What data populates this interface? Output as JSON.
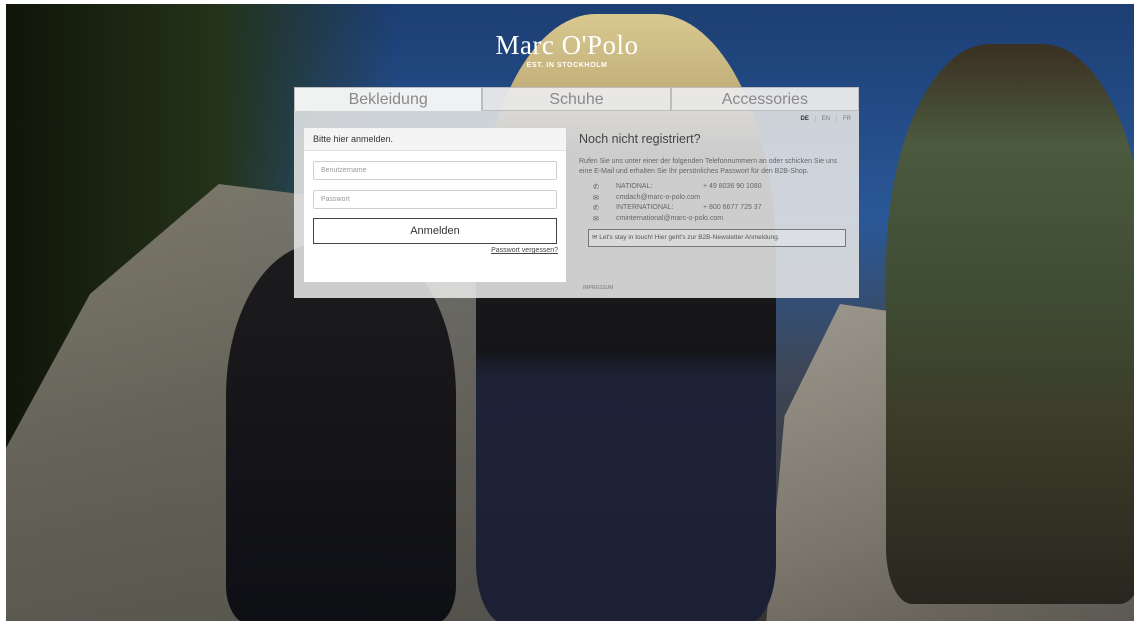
{
  "brand": {
    "name": "Marc O'Polo",
    "tagline": "EST. IN STOCKHOLM"
  },
  "tabs": [
    {
      "label": "Bekleidung",
      "active": true
    },
    {
      "label": "Schuhe",
      "active": false
    },
    {
      "label": "Accessories",
      "active": false
    }
  ],
  "languages": [
    "DE",
    "EN",
    "FR"
  ],
  "login": {
    "title": "Bitte hier anmelden.",
    "username_placeholder": "Benutzername",
    "password_placeholder": "Passwort",
    "submit_label": "Anmelden",
    "forgot_label": "Passwort vergessen?"
  },
  "register": {
    "title": "Noch nicht registriert?",
    "text": "Rufen Sie uns unter einer der folgenden Telefonnummern an oder schicken Sie uns eine E-Mail und erhalten Sie Ihr persönliches Passwort für den B2B-Shop.",
    "contacts": [
      {
        "icon": "phone-icon",
        "label": "NATIONAL:",
        "value": "+ 49 8036 90 1080"
      },
      {
        "icon": "mail-icon",
        "label": "cmdach@marc-o-polo.com",
        "value": ""
      },
      {
        "icon": "phone-icon",
        "label": "INTERNATIONAL:",
        "value": "+ 800 6677 725 37"
      },
      {
        "icon": "mail-icon",
        "label": "cminternational@marc-o-polo.com",
        "value": ""
      }
    ],
    "newsletter_label": "Let's stay in touch! Hier geht's zur B2B-Newsletter Anmeldung.",
    "impressum_label": "IMPRESSUM"
  }
}
